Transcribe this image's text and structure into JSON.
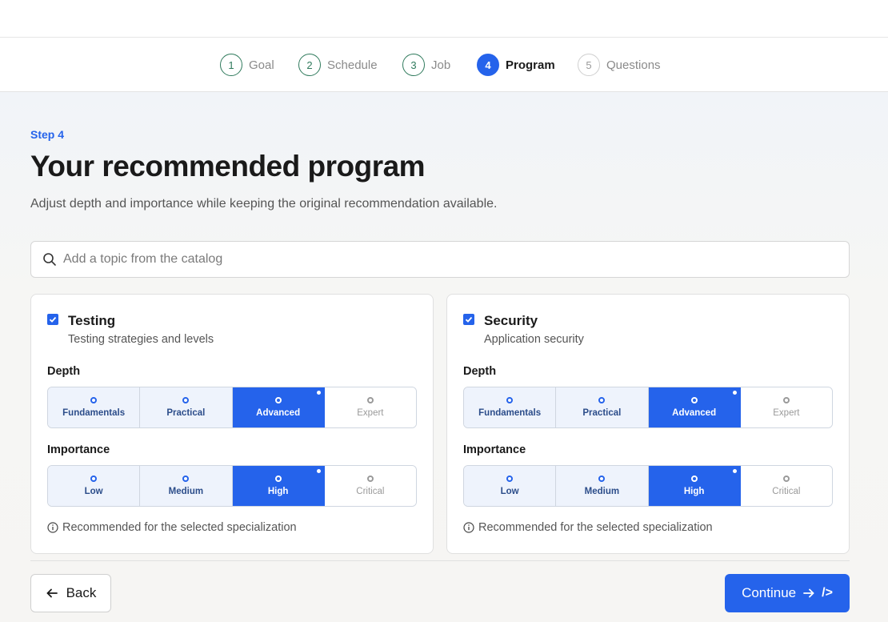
{
  "stepper": {
    "steps": [
      {
        "num": "1",
        "label": "Goal"
      },
      {
        "num": "2",
        "label": "Schedule"
      },
      {
        "num": "3",
        "label": "Job"
      },
      {
        "num": "4",
        "label": "Program"
      },
      {
        "num": "5",
        "label": "Questions"
      }
    ],
    "active_step": 4
  },
  "header": {
    "eyebrow": "Step 4",
    "title": "Your recommended program",
    "subtitle": "Adjust depth and importance while keeping the original recommendation available."
  },
  "search": {
    "placeholder": "Add a topic from the catalog",
    "value": ""
  },
  "cards": [
    {
      "checked": true,
      "name": "Testing",
      "description": "Testing strategies and levels",
      "depth_label": "Depth",
      "depth_options": [
        "Fundamentals",
        "Practical",
        "Advanced",
        "Expert"
      ],
      "depth_selected": "Advanced",
      "importance_label": "Importance",
      "importance_options": [
        "Low",
        "Medium",
        "High",
        "Critical"
      ],
      "importance_selected": "High",
      "note": "Recommended for the selected specialization"
    },
    {
      "checked": true,
      "name": "Security",
      "description": "Application security",
      "depth_label": "Depth",
      "depth_options": [
        "Fundamentals",
        "Practical",
        "Advanced",
        "Expert"
      ],
      "depth_selected": "Advanced",
      "importance_label": "Importance",
      "importance_options": [
        "Low",
        "Medium",
        "High",
        "Critical"
      ],
      "importance_selected": "High",
      "note": "Recommended for the selected specialization"
    }
  ],
  "footer": {
    "back_label": "Back",
    "continue_label": "Continue",
    "continue_suffix": "/>"
  },
  "colors": {
    "accent": "#2563eb",
    "done_step": "#2f7a5c"
  }
}
